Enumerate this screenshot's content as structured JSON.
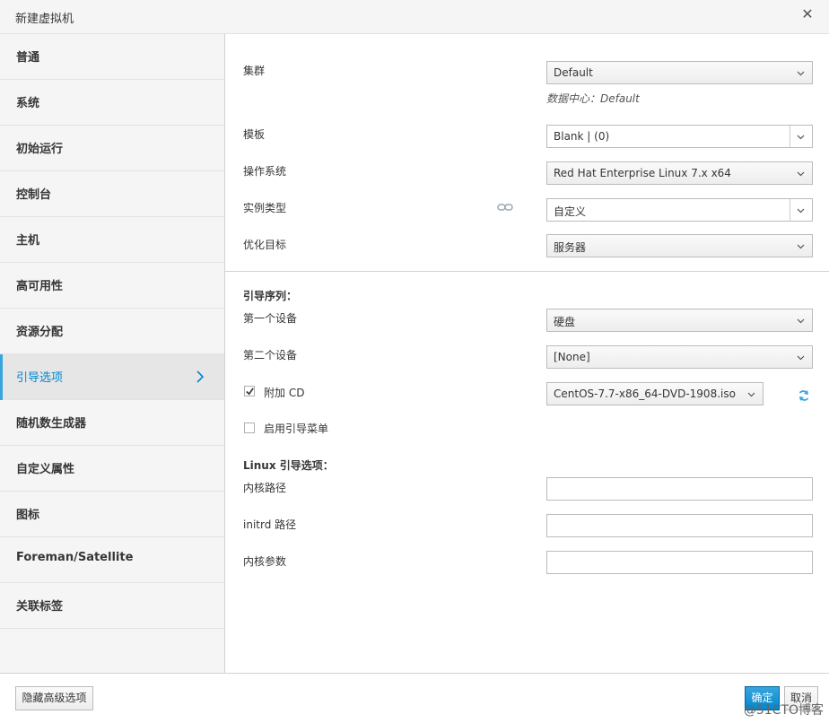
{
  "dialog": {
    "title": "新建虚拟机"
  },
  "sidebar": {
    "items": [
      {
        "label": "普通"
      },
      {
        "label": "系统"
      },
      {
        "label": "初始运行"
      },
      {
        "label": "控制台"
      },
      {
        "label": "主机"
      },
      {
        "label": "高可用性"
      },
      {
        "label": "资源分配"
      },
      {
        "label": "引导选项",
        "active": true
      },
      {
        "label": "随机数生成器"
      },
      {
        "label": "自定义属性"
      },
      {
        "label": "图标"
      },
      {
        "label": "Foreman/Satellite"
      },
      {
        "label": "关联标签"
      }
    ]
  },
  "form": {
    "cluster": {
      "label": "集群",
      "value": "Default",
      "help": "数据中心：Default"
    },
    "template": {
      "label": "模板",
      "value": "Blank |  (0)"
    },
    "os": {
      "label": "操作系统",
      "value": "Red Hat Enterprise Linux 7.x x64"
    },
    "instance_type": {
      "label": "实例类型",
      "value": "自定义"
    },
    "optimize": {
      "label": "优化目标",
      "value": "服务器"
    },
    "boot_sequence": {
      "title": "引导序列：",
      "first": {
        "label": "第一个设备",
        "value": "硬盘"
      },
      "second": {
        "label": "第二个设备",
        "value": "[None]"
      }
    },
    "attach_cd": {
      "label": "附加 CD",
      "checked": true,
      "value": "CentOS-7.7-x86_64-DVD-1908.iso"
    },
    "boot_menu": {
      "label": "启用引导菜单",
      "checked": false
    },
    "linux_boot": {
      "title": "Linux 引导选项：",
      "kernel_path": {
        "label": "内核路径",
        "value": ""
      },
      "initrd_path": {
        "label": "initrd 路径",
        "value": ""
      },
      "kernel_params": {
        "label": "内核参数",
        "value": ""
      }
    }
  },
  "footer": {
    "hide_advanced": "隐藏高级选项",
    "ok": "确定",
    "cancel": "取消",
    "watermark": "@51CTO博客"
  },
  "colors": {
    "accent": "#0088ce",
    "active_bar": "#39a5dc"
  },
  "icons": {
    "close": "close-icon",
    "chevron": "chevron-right-icon",
    "link": "link-icon",
    "refresh": "refresh-icon",
    "caret": "chevron-down-icon"
  }
}
